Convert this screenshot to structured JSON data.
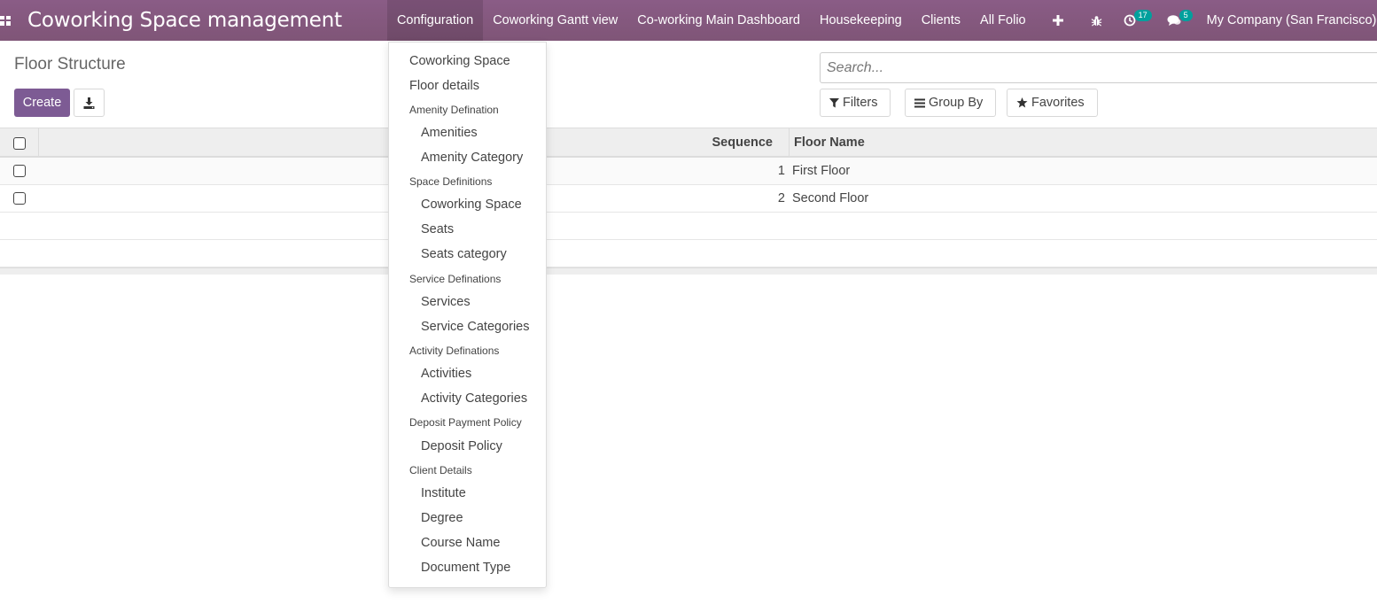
{
  "navbar": {
    "app_title": "Coworking Space management",
    "menus": [
      {
        "label": "Configuration",
        "active": true
      },
      {
        "label": "Coworking Gantt view"
      },
      {
        "label": "Co-working Main Dashboard"
      },
      {
        "label": "Housekeeping"
      },
      {
        "label": "Clients"
      },
      {
        "label": "All Folio"
      }
    ],
    "activity_count": "17",
    "message_count": "5",
    "company": "My Company (San Francisco)",
    "icons": [
      "apps-icon",
      "plus-icon",
      "bug-icon",
      "clock-icon",
      "chat-icon"
    ]
  },
  "control_panel": {
    "title": "Floor Structure",
    "create_label": "Create",
    "search_placeholder": "Search...",
    "filters_label": "Filters",
    "group_by_label": "Group By",
    "favorites_label": "Favorites"
  },
  "table": {
    "columns": [
      "Sequence",
      "Floor Name"
    ],
    "rows": [
      {
        "sequence": "1",
        "floor_name": "First Floor"
      },
      {
        "sequence": "2",
        "floor_name": "Second Floor"
      }
    ]
  },
  "dropdown": {
    "items": [
      {
        "type": "item",
        "label": "Coworking Space"
      },
      {
        "type": "item",
        "label": "Floor details"
      },
      {
        "type": "header",
        "label": "Amenity Defination"
      },
      {
        "type": "sub",
        "label": "Amenities"
      },
      {
        "type": "sub",
        "label": "Amenity Category"
      },
      {
        "type": "header",
        "label": "Space Definitions"
      },
      {
        "type": "sub",
        "label": "Coworking Space"
      },
      {
        "type": "sub",
        "label": "Seats"
      },
      {
        "type": "sub",
        "label": "Seats category"
      },
      {
        "type": "header",
        "label": "Service Definations"
      },
      {
        "type": "sub",
        "label": "Services"
      },
      {
        "type": "sub",
        "label": "Service Categories"
      },
      {
        "type": "header",
        "label": "Activity Definations"
      },
      {
        "type": "sub",
        "label": "Activities"
      },
      {
        "type": "sub",
        "label": "Activity Categories"
      },
      {
        "type": "header",
        "label": "Deposit Payment Policy"
      },
      {
        "type": "sub",
        "label": "Deposit Policy"
      },
      {
        "type": "header",
        "label": "Client Details"
      },
      {
        "type": "sub",
        "label": "Institute"
      },
      {
        "type": "sub",
        "label": "Degree"
      },
      {
        "type": "sub",
        "label": "Course Name"
      },
      {
        "type": "sub",
        "label": "Document Type"
      }
    ]
  }
}
